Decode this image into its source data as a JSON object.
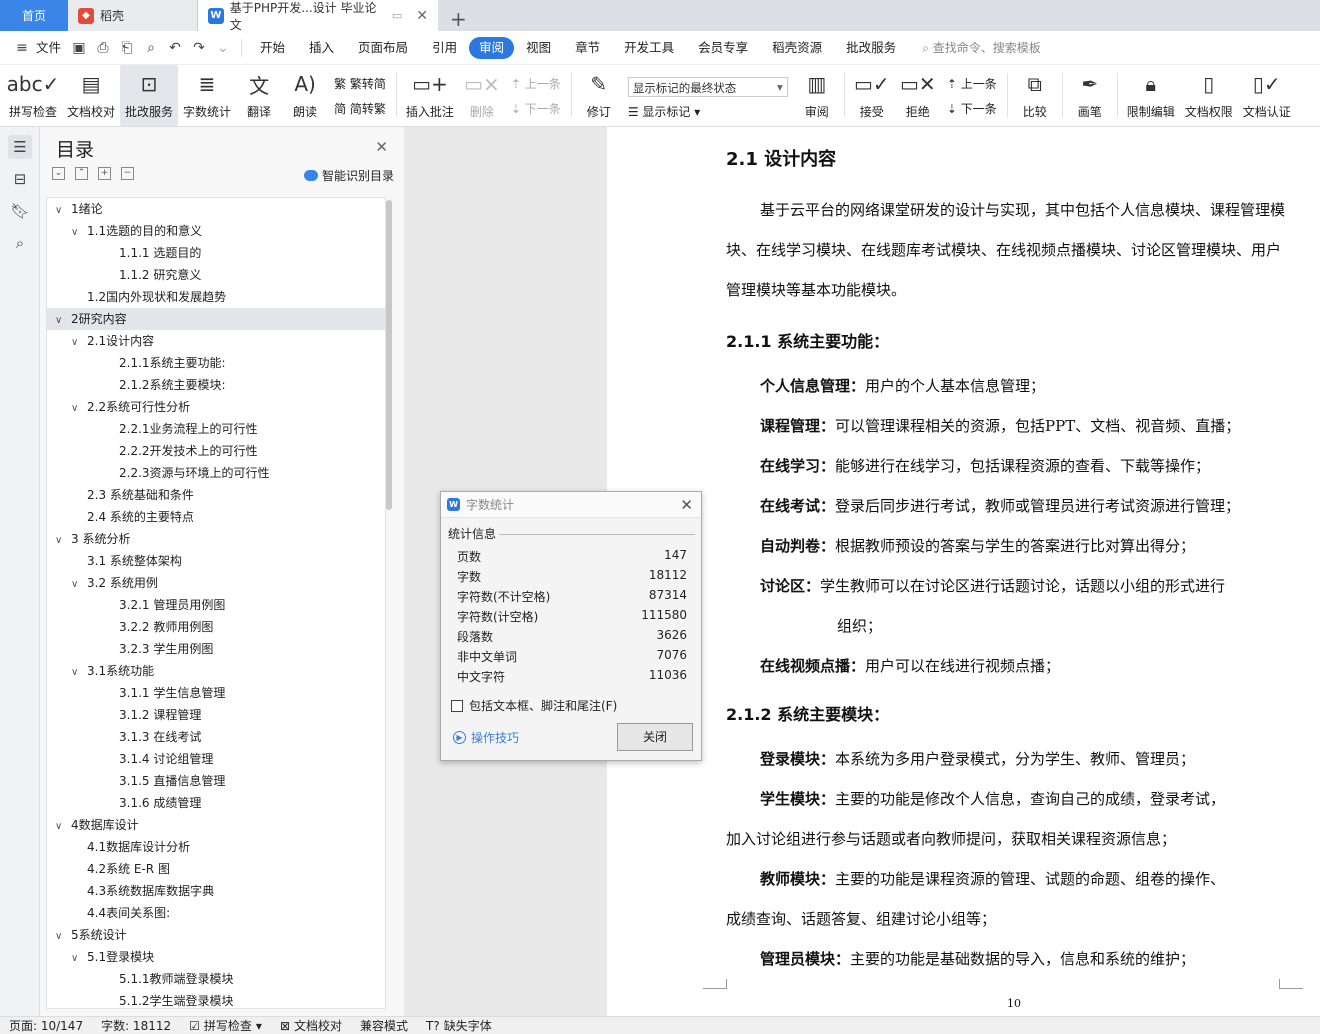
{
  "tabs": {
    "home": "首页",
    "doc1": "稻壳",
    "active": "基于PHP开发...设计 毕业论文"
  },
  "menubar": {
    "file": "文件",
    "items": [
      "开始",
      "插入",
      "页面布局",
      "引用",
      "审阅",
      "视图",
      "章节",
      "开发工具",
      "会员专享",
      "稻壳资源",
      "批改服务"
    ],
    "active_index": 4,
    "search": "查找命令、搜索模板"
  },
  "ribbon": {
    "spellcheck": "拼写检查",
    "proofread": "文档校对",
    "review_service": "批改服务",
    "word_count": "字数统计",
    "translate": "翻译",
    "read_aloud": "朗读",
    "to_traditional": "繁转简",
    "to_simplified": "简转繁",
    "insert_comment": "插入批注",
    "delete": "删除",
    "prev": "上一条",
    "next": "下一条",
    "revise": "修订",
    "markup_state": "显示标记的最终状态",
    "show_markup": "显示标记",
    "review": "审阅",
    "accept": "接受",
    "reject": "拒绝",
    "prev2": "上一条",
    "next2": "下一条",
    "compare": "比较",
    "pen": "画笔",
    "restrict_edit": "限制编辑",
    "doc_rights": "文档权限",
    "doc_cert": "文档认证"
  },
  "toc": {
    "title": "目录",
    "smart": "智能识别目录",
    "items": [
      {
        "text": "1绪论",
        "level": 0,
        "arrow": true
      },
      {
        "text": "1.1选题的目的和意义",
        "level": 1,
        "arrow": true
      },
      {
        "text": "1.1.1 选题目的",
        "level": 2,
        "arrow": false
      },
      {
        "text": "1.1.2 研究意义",
        "level": 2,
        "arrow": false
      },
      {
        "text": "1.2国内外现状和发展趋势",
        "level": 1,
        "arrow": false
      },
      {
        "text": "2研究内容",
        "level": 0,
        "arrow": true,
        "selected": true
      },
      {
        "text": "2.1设计内容",
        "level": 1,
        "arrow": true
      },
      {
        "text": "2.1.1系统主要功能:",
        "level": 2,
        "arrow": false
      },
      {
        "text": "2.1.2系统主要模块:",
        "level": 2,
        "arrow": false
      },
      {
        "text": "2.2系统可行性分析",
        "level": 1,
        "arrow": true
      },
      {
        "text": "2.2.1业务流程上的可行性",
        "level": 2,
        "arrow": false
      },
      {
        "text": "2.2.2开发技术上的可行性",
        "level": 2,
        "arrow": false
      },
      {
        "text": "2.2.3资源与环境上的可行性",
        "level": 2,
        "arrow": false
      },
      {
        "text": "2.3  系统基础和条件",
        "level": 1,
        "arrow": false
      },
      {
        "text": "2.4 系统的主要特点",
        "level": 1,
        "arrow": false
      },
      {
        "text": "3 系统分析",
        "level": 0,
        "arrow": true
      },
      {
        "text": "3.1  系统整体架构",
        "level": 1,
        "arrow": false
      },
      {
        "text": "3.2  系统用例",
        "level": 1,
        "arrow": true
      },
      {
        "text": "3.2.1  管理员用例图",
        "level": 2,
        "arrow": false
      },
      {
        "text": "3.2.2  教师用例图",
        "level": 2,
        "arrow": false
      },
      {
        "text": "3.2.3  学生用例图",
        "level": 2,
        "arrow": false
      },
      {
        "text": "3.1系统功能",
        "level": 1,
        "arrow": true
      },
      {
        "text": "3.1.1 学生信息管理",
        "level": 2,
        "arrow": false
      },
      {
        "text": "3.1.2 课程管理",
        "level": 2,
        "arrow": false
      },
      {
        "text": "3.1.3 在线考试",
        "level": 2,
        "arrow": false
      },
      {
        "text": "3.1.4 讨论组管理",
        "level": 2,
        "arrow": false
      },
      {
        "text": "3.1.5  直播信息管理",
        "level": 2,
        "arrow": false
      },
      {
        "text": "3.1.6 成绩管理",
        "level": 2,
        "arrow": false
      },
      {
        "text": "4数据库设计",
        "level": 0,
        "arrow": true
      },
      {
        "text": "4.1数据库设计分析",
        "level": 1,
        "arrow": false
      },
      {
        "text": "4.2系统 E-R 图",
        "level": 1,
        "arrow": false
      },
      {
        "text": "4.3系统数据库数据字典",
        "level": 1,
        "arrow": false
      },
      {
        "text": "4.4表间关系图:",
        "level": 1,
        "arrow": false
      },
      {
        "text": "5系统设计",
        "level": 0,
        "arrow": true
      },
      {
        "text": "5.1登录模块",
        "level": 1,
        "arrow": true
      },
      {
        "text": "5.1.1教师端登录模块",
        "level": 2,
        "arrow": false
      },
      {
        "text": "5.1.2学生端登录模块",
        "level": 2,
        "arrow": false
      }
    ]
  },
  "document": {
    "h2": "2.1  设计内容",
    "intro": "基于云平台的网络课堂研发的设计与实现，其中包括个人信息模块、课程管理模块、在线学习模块、在线题库考试模块、在线视频点播模块、讨论区管理模块、用户管理模块等基本功能模块。",
    "h3a": "2.1.1 系统主要功能：",
    "functions": [
      {
        "label": "个人信息管理：",
        "text": "用户的个人基本信息管理；"
      },
      {
        "label": "课程管理：",
        "text": "可以管理课程相关的资源，包括PPT、文档、视音频、直播；"
      },
      {
        "label": "在线学习：",
        "text": "能够进行在线学习，包括课程资源的查看、下载等操作；"
      },
      {
        "label": "在线考试：",
        "text": "登录后同步进行考试，教师或管理员进行考试资源进行管理；"
      },
      {
        "label": "自动判卷：",
        "text": "根据教师预设的答案与学生的答案进行比对算出得分；"
      },
      {
        "label": "讨论区：",
        "text": "学生教师可以在讨论区进行话题讨论，话题以小组的形式进行"
      }
    ],
    "func_cont": "组织；",
    "func_last": {
      "label": "在线视频点播：",
      "text": "用户可以在线进行视频点播；"
    },
    "h3b": "2.1.2 系统主要模块：",
    "mod_login": {
      "label": "登录模块：",
      "text": "本系统为多用户登录模式，分为学生、教师、管理员；"
    },
    "mod_student": {
      "label": "学生模块：",
      "text": "主要的功能是修改个人信息，查询自己的成绩，登录考试，"
    },
    "mod_student_cont": "加入讨论组进行参与话题或者向教师提问，获取相关课程资源信息；",
    "mod_teacher": {
      "label": "教师模块：",
      "text": "主要的功能是课程资源的管理、试题的命题、组卷的操作、"
    },
    "mod_teacher_cont": "成绩查询、话题答复、组建讨论小组等；",
    "mod_admin": {
      "label": "管理员模块：",
      "text": "主要的功能是基础数据的导入，信息和系统的维护；"
    },
    "page_number": "10"
  },
  "dialog": {
    "title": "字数统计",
    "section": "统计信息",
    "stats": [
      {
        "label": "页数",
        "value": "147"
      },
      {
        "label": "字数",
        "value": "18112"
      },
      {
        "label": "字符数(不计空格)",
        "value": "87314"
      },
      {
        "label": "字符数(计空格)",
        "value": "111580"
      },
      {
        "label": "段落数",
        "value": "3626"
      },
      {
        "label": "非中文单词",
        "value": "7076"
      },
      {
        "label": "中文字符",
        "value": "11036"
      }
    ],
    "checkbox": "包括文本框、脚注和尾注(F)",
    "tips": "操作技巧",
    "close": "关闭"
  },
  "status": {
    "page": "页面: 10/147",
    "words": "字数: 18112",
    "spell": "拼写检查",
    "proof": "文档校对",
    "compat": "兼容模式",
    "missing_font": "缺失字体"
  }
}
